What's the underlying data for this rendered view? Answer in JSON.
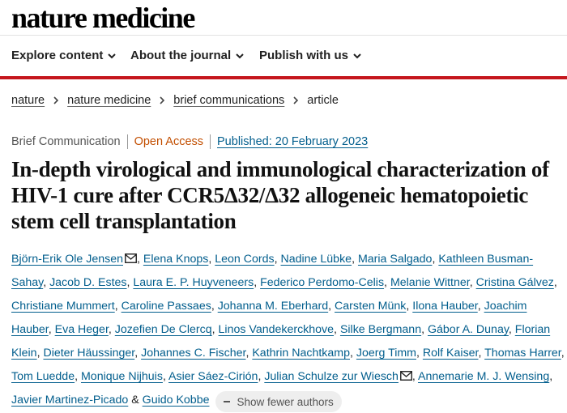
{
  "header": {
    "logo": "nature medicine"
  },
  "nav": {
    "items": [
      {
        "label": "Explore content"
      },
      {
        "label": "About the journal"
      },
      {
        "label": "Publish with us"
      }
    ],
    "accent_color": "#c5161d"
  },
  "breadcrumb": [
    "nature",
    "nature medicine",
    "brief communications",
    "article"
  ],
  "meta": {
    "type": "Brief Communication",
    "access": "Open Access",
    "published": "Published: 20 February 2023"
  },
  "title": "In-depth virological and immunological characterization of HIV-1 cure after CCR5Δ32/Δ32 allogeneic hematopoietic stem cell transplantation",
  "authors": {
    "list": [
      "Björn-Erik Ole Jensen",
      "Elena Knops",
      "Leon Cords",
      "Nadine Lübke",
      "Maria Salgado",
      "Kathleen Busman-Sahay",
      "Jacob D. Estes",
      "Laura E. P. Huyveneers",
      "Federico Perdomo-Celis",
      "Melanie Wittner",
      "Cristina Gálvez",
      "Christiane Mummert",
      "Caroline Passaes",
      "Johanna M. Eberhard",
      "Carsten Münk",
      "Ilona Hauber",
      "Joachim Hauber",
      "Eva Heger",
      "Jozefien De Clercq",
      "Linos Vandekerckhove",
      "Silke Bergmann",
      "Gábor A. Dunay",
      "Florian Klein",
      "Dieter Häussinger",
      "Johannes C. Fischer",
      "Kathrin Nachtkamp",
      "Joerg Timm",
      "Rolf Kaiser",
      "Thomas Harrer",
      "Tom Luedde",
      "Monique Nijhuis",
      "Asier Sáez-Cirión",
      "Julian Schulze zur Wiesch",
      "Annemarie M. J. Wensing",
      "Javier Martinez-Picado",
      "Guido Kobbe"
    ],
    "separator": ",",
    "ampersand": "&",
    "toggle_label": "Show fewer authors",
    "link_color": "#025e8d"
  },
  "icons": [
    "chevron-down-icon",
    "chevron-right-icon",
    "mail-icon",
    "minus-icon"
  ]
}
